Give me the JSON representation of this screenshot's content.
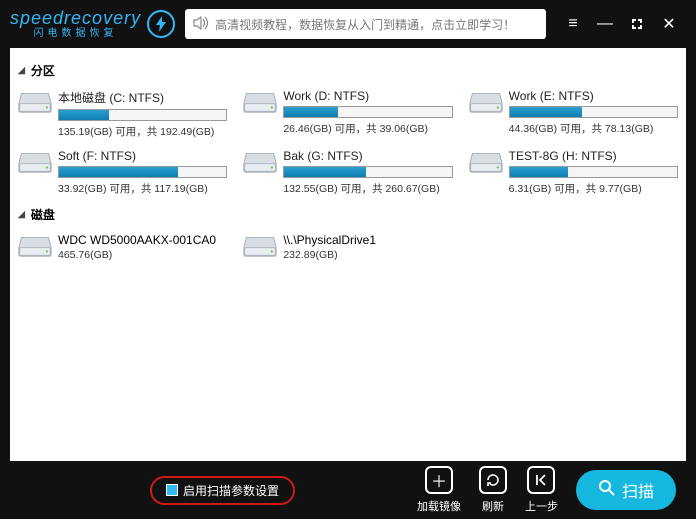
{
  "brand": {
    "main1": "speed",
    "main2": "recovery",
    "sub": "闪电数据恢复"
  },
  "tutorial_text": "高清视频教程，数据恢复从入门到精通，点击立即学习！",
  "sections": {
    "partitions": "分区",
    "disks": "磁盘"
  },
  "partitions": [
    {
      "name": "本地磁盘 (C: NTFS)",
      "usedPct": 30,
      "stat": "135.19(GB) 可用，共 192.49(GB)"
    },
    {
      "name": "Work (D: NTFS)",
      "usedPct": 32,
      "stat": "26.46(GB) 可用，共 39.06(GB)"
    },
    {
      "name": "Work (E: NTFS)",
      "usedPct": 43,
      "stat": "44.36(GB) 可用，共 78.13(GB)"
    },
    {
      "name": "Soft (F: NTFS)",
      "usedPct": 71,
      "stat": "33.92(GB) 可用，共 117.19(GB)"
    },
    {
      "name": "Bak (G: NTFS)",
      "usedPct": 49,
      "stat": "132.55(GB) 可用，共 260.67(GB)"
    },
    {
      "name": "TEST-8G (H: NTFS)",
      "usedPct": 35,
      "stat": "6.31(GB) 可用，共 9.77(GB)"
    }
  ],
  "disks": [
    {
      "name": "WDC WD5000AAKX-001CA0",
      "stat": "465.76(GB)"
    },
    {
      "name": "\\\\.\\PhysicalDrive1",
      "stat": "232.89(GB)"
    }
  ],
  "footer": {
    "scan_params": "启用扫描参数设置",
    "add_image": "加载镜像",
    "refresh": "刷新",
    "prev": "上一步",
    "scan": "扫描"
  }
}
